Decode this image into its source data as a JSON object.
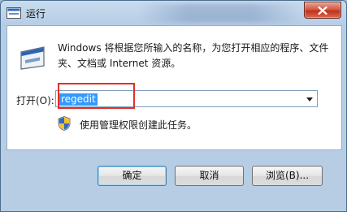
{
  "window": {
    "title": "运行",
    "close_icon": "close-icon"
  },
  "content": {
    "description": "Windows 将根据您所输入的名称，为您打开相应的程序、文件夹、文档或 Internet 资源。",
    "open_label": "打开(O):",
    "open_value": "regedit",
    "admin_notice": "使用管理权限创建此任务。"
  },
  "buttons": {
    "ok": "确定",
    "cancel": "取消",
    "browse": "浏览(B)..."
  },
  "colors": {
    "selection": "#3399ff",
    "highlight_box": "#e0302b",
    "close_button": "#c2321d"
  }
}
